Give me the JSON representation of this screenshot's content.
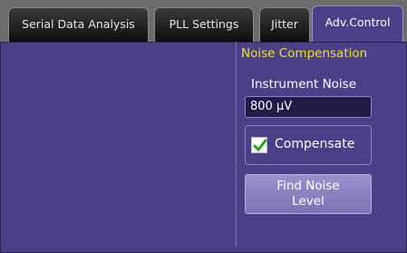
{
  "tabs": [
    {
      "label": "Serial Data Analysis"
    },
    {
      "label": "PLL Settings"
    },
    {
      "label": "Jitter"
    },
    {
      "label": "Adv.Control",
      "active": true
    }
  ],
  "noise_compensation": {
    "title": "Noise Compensation",
    "instrument_noise_label": "Instrument Noise",
    "instrument_noise_value": "800 µV",
    "compensate_label": "Compensate",
    "compensate_checked": true,
    "find_button_line1": "Find Noise",
    "find_button_line2": "Level"
  },
  "colors": {
    "panel": "#4b3f87",
    "title_yellow": "#f0e130",
    "check_green": "#2aa01a"
  }
}
